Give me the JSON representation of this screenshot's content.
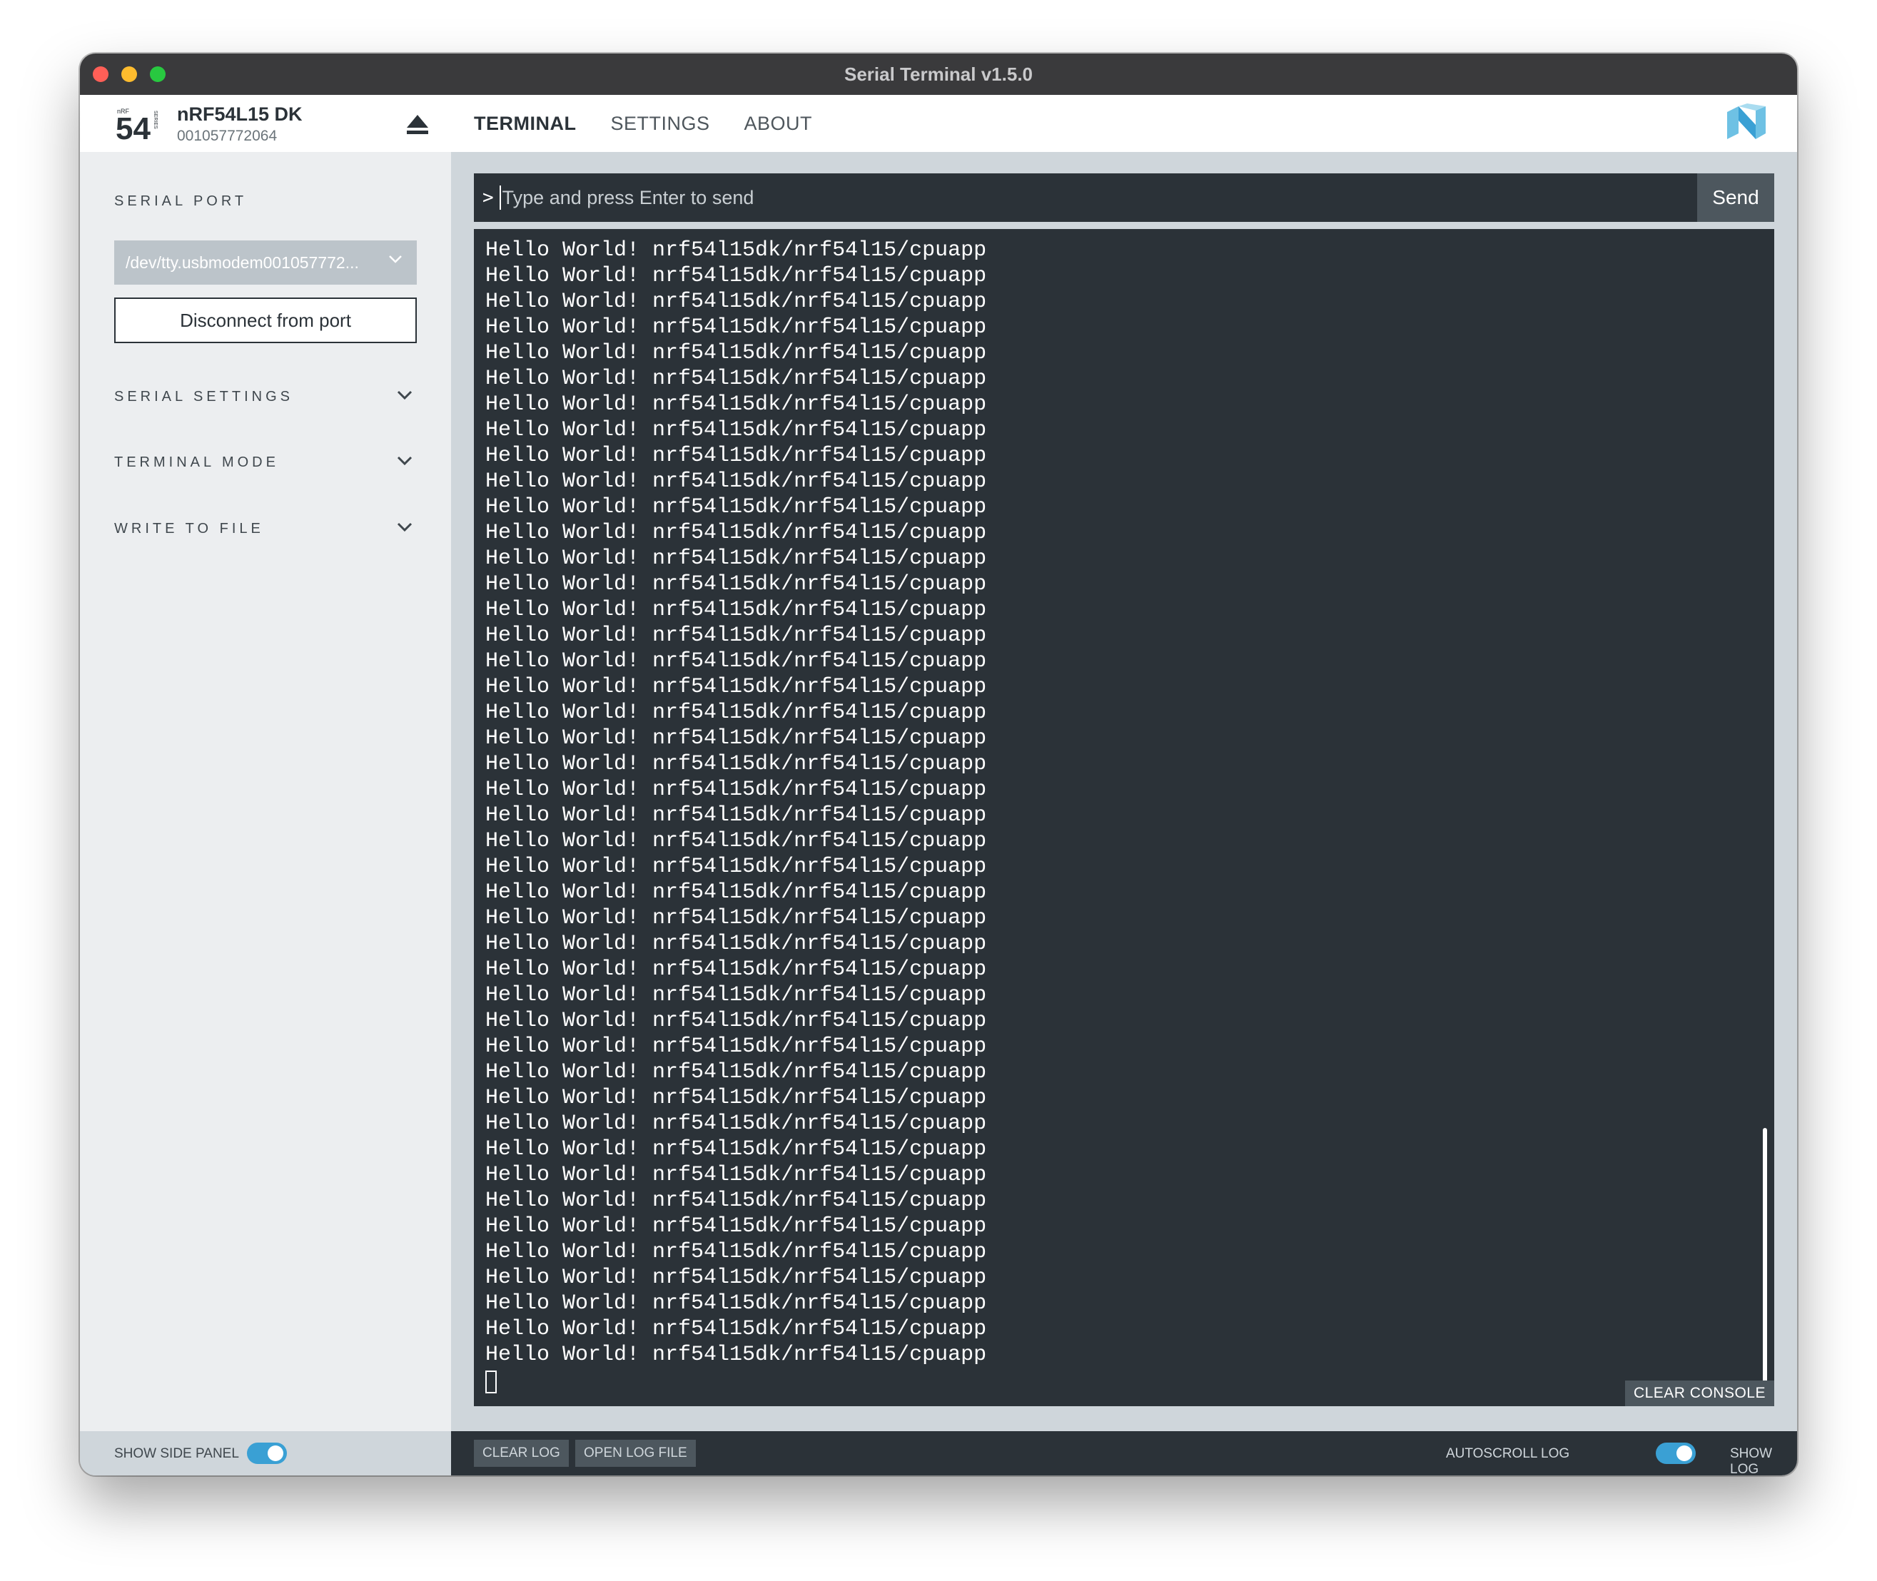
{
  "window": {
    "title": "Serial Terminal v1.5.0"
  },
  "device": {
    "name": "nRF54L15 DK",
    "serial": "001057772064",
    "logo_text": "54",
    "logo_small_top": "nRF",
    "logo_small_side": "SERIES"
  },
  "nav": {
    "tabs": [
      {
        "label": "TERMINAL",
        "active": true
      },
      {
        "label": "SETTINGS",
        "active": false
      },
      {
        "label": "ABOUT",
        "active": false
      }
    ]
  },
  "sidepanel": {
    "serial_port_heading": "SERIAL PORT",
    "port_value": "/dev/tty.usbmodem001057772...",
    "disconnect_label": "Disconnect from port",
    "sections": [
      "SERIAL SETTINGS",
      "TERMINAL MODE",
      "WRITE TO FILE"
    ]
  },
  "terminal": {
    "prompt": ">",
    "input_placeholder": "Type and press Enter to send",
    "send_label": "Send",
    "line_text": "Hello World! nrf54l15dk/nrf54l15/cpuapp",
    "line_count": 44,
    "clear_console_label": "CLEAR CONSOLE"
  },
  "statusbar": {
    "show_side_panel_label": "SHOW SIDE PANEL",
    "show_side_panel_on": true,
    "clear_log_label": "CLEAR LOG",
    "open_log_file_label": "OPEN LOG FILE",
    "autoscroll_label": "AUTOSCROLL LOG",
    "autoscroll_on": true,
    "show_log_label": "SHOW LOG",
    "show_log_on": false
  },
  "colors": {
    "accent": "#3aa0d4",
    "dark": "#2b3238",
    "panel": "#eceef0",
    "main_bg": "#cfd6db"
  }
}
